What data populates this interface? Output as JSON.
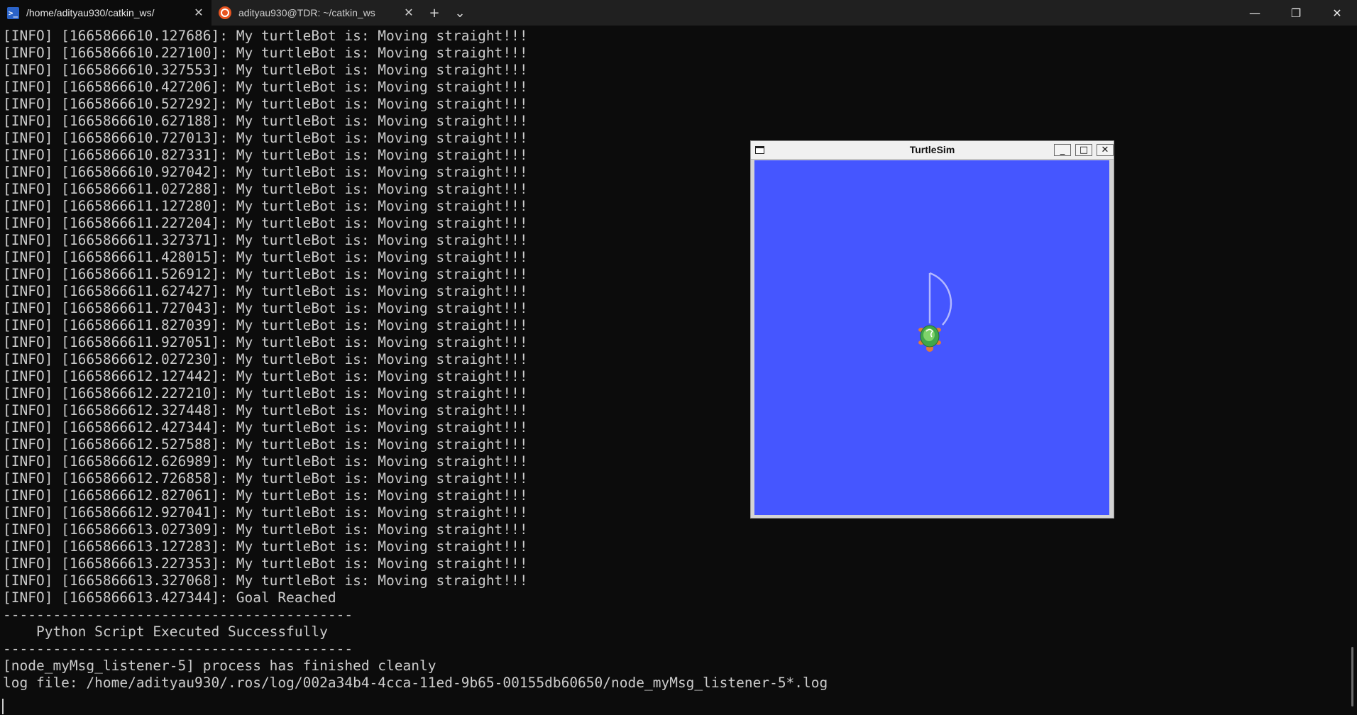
{
  "tabs": [
    {
      "title": "/home/adityau930/catkin_ws/",
      "active": true,
      "icon": "powershell-icon"
    },
    {
      "title": "adityau930@TDR: ~/catkin_ws",
      "active": false,
      "icon": "ubuntu-icon"
    }
  ],
  "tab_controls": {
    "new_tab": "+",
    "dropdown": "⌄"
  },
  "window_controls": {
    "minimize": "—",
    "restore": "❐",
    "close": "✕"
  },
  "terminal": {
    "lines": [
      "[INFO] [1665866610.127686]: My turtleBot is: Moving straight!!!",
      "[INFO] [1665866610.227100]: My turtleBot is: Moving straight!!!",
      "[INFO] [1665866610.327553]: My turtleBot is: Moving straight!!!",
      "[INFO] [1665866610.427206]: My turtleBot is: Moving straight!!!",
      "[INFO] [1665866610.527292]: My turtleBot is: Moving straight!!!",
      "[INFO] [1665866610.627188]: My turtleBot is: Moving straight!!!",
      "[INFO] [1665866610.727013]: My turtleBot is: Moving straight!!!",
      "[INFO] [1665866610.827331]: My turtleBot is: Moving straight!!!",
      "[INFO] [1665866610.927042]: My turtleBot is: Moving straight!!!",
      "[INFO] [1665866611.027288]: My turtleBot is: Moving straight!!!",
      "[INFO] [1665866611.127280]: My turtleBot is: Moving straight!!!",
      "[INFO] [1665866611.227204]: My turtleBot is: Moving straight!!!",
      "[INFO] [1665866611.327371]: My turtleBot is: Moving straight!!!",
      "[INFO] [1665866611.428015]: My turtleBot is: Moving straight!!!",
      "[INFO] [1665866611.526912]: My turtleBot is: Moving straight!!!",
      "[INFO] [1665866611.627427]: My turtleBot is: Moving straight!!!",
      "[INFO] [1665866611.727043]: My turtleBot is: Moving straight!!!",
      "[INFO] [1665866611.827039]: My turtleBot is: Moving straight!!!",
      "[INFO] [1665866611.927051]: My turtleBot is: Moving straight!!!",
      "[INFO] [1665866612.027230]: My turtleBot is: Moving straight!!!",
      "[INFO] [1665866612.127442]: My turtleBot is: Moving straight!!!",
      "[INFO] [1665866612.227210]: My turtleBot is: Moving straight!!!",
      "[INFO] [1665866612.327448]: My turtleBot is: Moving straight!!!",
      "[INFO] [1665866612.427344]: My turtleBot is: Moving straight!!!",
      "[INFO] [1665866612.527588]: My turtleBot is: Moving straight!!!",
      "[INFO] [1665866612.626989]: My turtleBot is: Moving straight!!!",
      "[INFO] [1665866612.726858]: My turtleBot is: Moving straight!!!",
      "[INFO] [1665866612.827061]: My turtleBot is: Moving straight!!!",
      "[INFO] [1665866612.927041]: My turtleBot is: Moving straight!!!",
      "[INFO] [1665866613.027309]: My turtleBot is: Moving straight!!!",
      "[INFO] [1665866613.127283]: My turtleBot is: Moving straight!!!",
      "[INFO] [1665866613.227353]: My turtleBot is: Moving straight!!!",
      "[INFO] [1665866613.327068]: My turtleBot is: Moving straight!!!",
      "[INFO] [1665866613.427344]: Goal Reached",
      "------------------------------------------",
      "    Python Script Executed Successfully",
      "------------------------------------------",
      "[node_myMsg_listener-5] process has finished cleanly",
      "log file: /home/adityau930/.ros/log/002a34b4-4cca-11ed-9b65-00155db60650/node_myMsg_listener-5*.log"
    ]
  },
  "turtlesim": {
    "title": "TurtleSim",
    "buttons": {
      "minimize": "_",
      "maximize": "□",
      "close": "✕"
    },
    "background_color": "#4556ff",
    "pen_color": "#b3b8ff",
    "turtle_icon": "turtle-icon"
  }
}
